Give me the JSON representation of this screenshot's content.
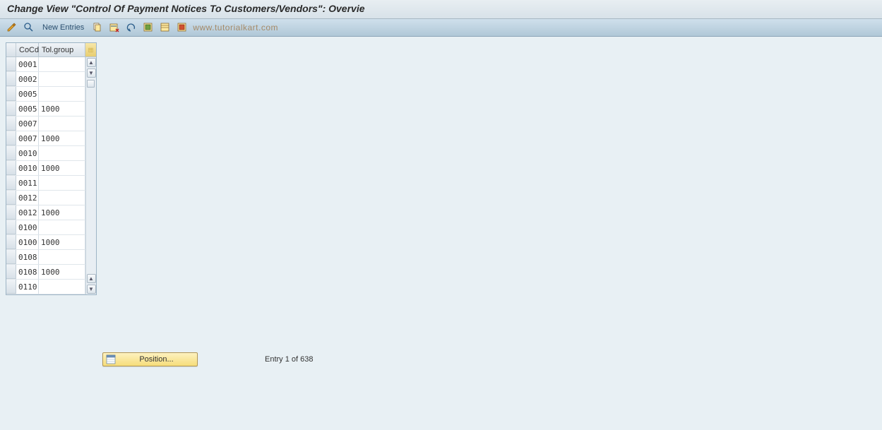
{
  "header": {
    "title": "Change View \"Control Of Payment Notices To Customers/Vendors\": Overvie"
  },
  "toolbar": {
    "new_entries_label": "New Entries",
    "watermark_text": "www.tutorialkart.com"
  },
  "table": {
    "columns": {
      "cocd": "CoCd",
      "tolgroup": "Tol.group"
    },
    "rows": [
      {
        "cocd": "0001",
        "tol": ""
      },
      {
        "cocd": "0002",
        "tol": ""
      },
      {
        "cocd": "0005",
        "tol": ""
      },
      {
        "cocd": "0005",
        "tol": "1000"
      },
      {
        "cocd": "0007",
        "tol": ""
      },
      {
        "cocd": "0007",
        "tol": "1000"
      },
      {
        "cocd": "0010",
        "tol": ""
      },
      {
        "cocd": "0010",
        "tol": "1000"
      },
      {
        "cocd": "0011",
        "tol": ""
      },
      {
        "cocd": "0012",
        "tol": ""
      },
      {
        "cocd": "0012",
        "tol": "1000"
      },
      {
        "cocd": "0100",
        "tol": ""
      },
      {
        "cocd": "0100",
        "tol": "1000"
      },
      {
        "cocd": "0108",
        "tol": ""
      },
      {
        "cocd": "0108",
        "tol": "1000"
      },
      {
        "cocd": "0110",
        "tol": ""
      }
    ]
  },
  "footer": {
    "position_label": "Position...",
    "entry_status": "Entry 1 of 638"
  }
}
